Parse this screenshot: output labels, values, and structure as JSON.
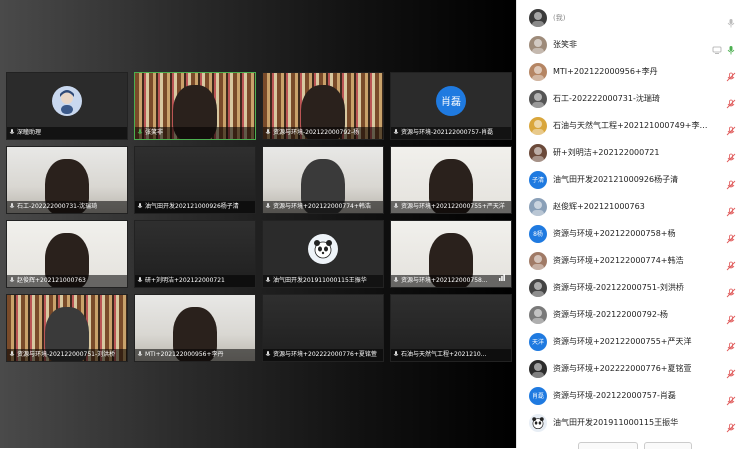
{
  "tiles": [
    {
      "caption": "深瞳助理",
      "kind": "avatar",
      "avatar_label": "",
      "avatar_color": "#c9d8ef"
    },
    {
      "caption": "张笑非",
      "kind": "shelf"
    },
    {
      "caption": "资源与环境-202122000792-杨",
      "kind": "shelf"
    },
    {
      "caption": "资源与环境-202122000757-肖磊",
      "kind": "avatar",
      "avatar_label": "肖磊",
      "avatar_color": "#1f7ae0"
    },
    {
      "caption": "石工-202222000731-沈瑞琦",
      "kind": "office"
    },
    {
      "caption": "油气田开发202121000926杨子清",
      "kind": "dark"
    },
    {
      "caption": "资源与环境+202122000774+韩浩",
      "kind": "office"
    },
    {
      "caption": "资源与环境+202122000755+严天洋",
      "kind": "room"
    },
    {
      "caption": "赵俊辉+202121000763",
      "kind": "room"
    },
    {
      "caption": "研+刘明洁+202122000721",
      "kind": "dark"
    },
    {
      "caption": "油气田开发201911000115王振华",
      "kind": "panda"
    },
    {
      "caption": "资源与环境+202122000758...",
      "kind": "room"
    },
    {
      "caption": "资源与环境-202122000751-刘洪桥",
      "kind": "shelf"
    },
    {
      "caption": "MTI+202122000956+李丹",
      "kind": "office"
    },
    {
      "caption": "资源与环境+202222000776+夏铭萱",
      "kind": "dark"
    },
    {
      "caption": "石油与天然气工程+2021210...",
      "kind": "dark"
    }
  ],
  "participants": [
    {
      "name": "(我)",
      "avatar_color": "#3b3b3b",
      "avatar_label": "",
      "mic": "on"
    },
    {
      "name": "张笑非",
      "avatar_color": "#9e8b7a",
      "avatar_label": "",
      "mic": "on-green"
    },
    {
      "name": "MTI+202122000956+李丹",
      "avatar_color": "#b58563",
      "avatar_label": "",
      "mic": "muted"
    },
    {
      "name": "石工-202222000731-沈瑞琦",
      "avatar_color": "#555",
      "avatar_label": "",
      "mic": "muted"
    },
    {
      "name": "石油与天然气工程+202121000749+李晓...",
      "avatar_color": "#d9a63c",
      "avatar_label": "",
      "mic": "muted"
    },
    {
      "name": "研+刘明洁+202122000721",
      "avatar_color": "#6b4a3a",
      "avatar_label": "",
      "mic": "muted"
    },
    {
      "name": "油气田开发202121000926杨子清",
      "avatar_color": "#1f7ae0",
      "avatar_label": "子清",
      "mic": "muted"
    },
    {
      "name": "赵俊辉+202121000763",
      "avatar_color": "#8aa0b8",
      "avatar_label": "",
      "mic": "muted"
    },
    {
      "name": "资源与环境+202122000758+杨",
      "avatar_color": "#1f7ae0",
      "avatar_label": "8杨",
      "mic": "muted"
    },
    {
      "name": "资源与环境+202122000774+韩浩",
      "avatar_color": "#a07a66",
      "avatar_label": "",
      "mic": "muted"
    },
    {
      "name": "资源与环境-202122000751-刘洪桥",
      "avatar_color": "#444",
      "avatar_label": "",
      "mic": "muted"
    },
    {
      "name": "资源与环境-202122000792-杨",
      "avatar_color": "#7a7a7a",
      "avatar_label": "",
      "mic": "muted"
    },
    {
      "name": "资源与环境+202122000755+严天洋",
      "avatar_color": "#1f7ae0",
      "avatar_label": "天洋",
      "mic": "muted"
    },
    {
      "name": "资源与环境+202222000776+夏铭萱",
      "avatar_color": "#2c2c2c",
      "avatar_label": "",
      "mic": "muted"
    },
    {
      "name": "资源与环境-202122000757-肖磊",
      "avatar_color": "#1f7ae0",
      "avatar_label": "肖磊",
      "mic": "muted"
    },
    {
      "name": "油气田开发201911000115王振华",
      "avatar_color": "#e8eef5",
      "avatar_label": "",
      "mic": "muted"
    }
  ],
  "colors": {
    "accent": "#1f7ae0",
    "muted_mic": "#e05a5a",
    "active_mic": "#4caf50"
  }
}
